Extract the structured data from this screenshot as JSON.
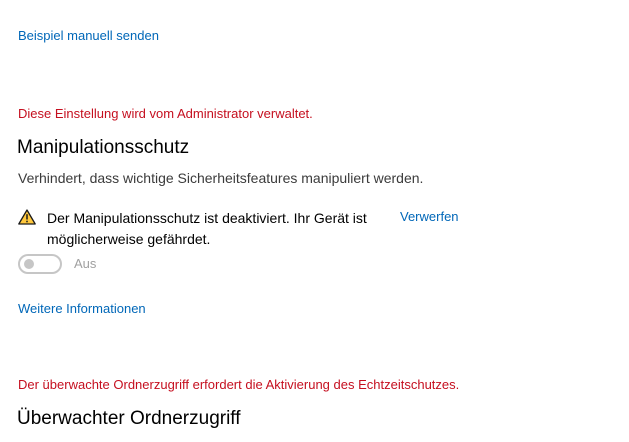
{
  "links": {
    "submit_sample": "Beispiel manuell senden",
    "more_info": "Weitere Informationen"
  },
  "tamper_protection": {
    "admin_note": "Diese Einstellung wird vom Administrator verwaltet.",
    "title": "Manipulationsschutz",
    "description": "Verhindert, dass wichtige Sicherheitsfeatures manipuliert werden.",
    "warning_text": "Der Manipulationsschutz ist deaktiviert. Ihr Gerät ist möglicherweise gefährdet.",
    "warning_icon": "warning-triangle-icon",
    "dismiss_label": "Verwerfen",
    "toggle_state": "Aus",
    "toggle_on": false
  },
  "controlled_folder_access": {
    "admin_note": "Der überwachte Ordnerzugriff erfordert die Aktivierung des Echtzeitschutzes.",
    "title": "Überwachter Ordnerzugriff"
  },
  "colors": {
    "link": "#0067b8",
    "admin_note": "#c50f1f",
    "warning_fill": "#ffc83d",
    "toggle_disabled": "#c6c6c6"
  }
}
